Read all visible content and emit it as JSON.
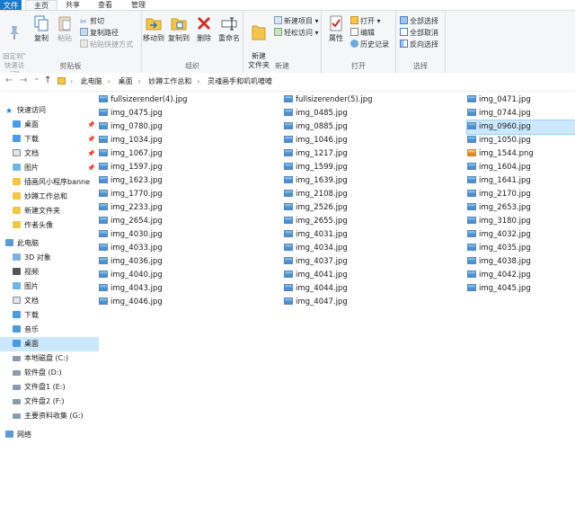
{
  "ribbon_tabs": [
    "文件",
    "主页",
    "共享",
    "查看",
    "管理"
  ],
  "ribbon": {
    "clipboard": {
      "pin": "固定到\"\n快速访问\"",
      "copy": "复制",
      "paste": "粘贴",
      "cut": "剪切",
      "copy_path": "复制路径",
      "paste_shortcut": "粘贴快捷方式",
      "label": "剪贴板"
    },
    "organize": {
      "move_to": "移动到",
      "copy_to": "复制到",
      "delete": "删除",
      "rename": "重命名",
      "label": "组织"
    },
    "new": {
      "new_folder": "新建\n文件夹",
      "new_item": "新建项目 ▾",
      "easy_access": "轻松访问 ▾",
      "label": "新建"
    },
    "open": {
      "properties": "属性",
      "open": "打开 ▾",
      "edit": "编辑",
      "history": "历史记录",
      "label": "打开"
    },
    "select": {
      "select_all": "全部选择",
      "select_none": "全部取消",
      "invert": "反向选择",
      "label": "选择"
    }
  },
  "address": {
    "back": "←",
    "forward": "→",
    "recent": "⌄",
    "up": "↑",
    "crumbs": [
      "此电脑",
      "桌面",
      "妙蹲工作总和",
      "灵魂画手和叽叽喳喳"
    ]
  },
  "nav": {
    "quick_access": "快速访问",
    "quick_items": [
      "桌面",
      "下载",
      "文档",
      "图片",
      "插画风小程序banne",
      "妙蹲工作总和",
      "新建文件夹",
      "作者头像"
    ],
    "this_pc": "此电脑",
    "pc_items": [
      "3D 对象",
      "视频",
      "图片",
      "文档",
      "下载",
      "音乐",
      "桌面",
      "本地磁盘 (C:)",
      "软件盘 (D:)",
      "文件盘1 (E:)",
      "文件盘2 (F:)",
      "主要资料收集 (G:)"
    ],
    "network": "网络"
  },
  "files": {
    "col1": [
      "fullsizerender(4).jpg",
      "img_0475.jpg",
      "img_0780.jpg",
      "img_1034.jpg",
      "img_1067.jpg",
      "img_1597.jpg",
      "img_1623.jpg",
      "img_1770.jpg",
      "img_2233.jpg",
      "img_2654.jpg",
      "img_4030.jpg",
      "img_4033.jpg",
      "img_4036.jpg",
      "img_4040.jpg",
      "img_4043.jpg",
      "img_4046.jpg"
    ],
    "col2": [
      "fullsizerender(5).jpg",
      "img_0485.jpg",
      "img_0885.jpg",
      "img_1046.jpg",
      "img_1217.jpg",
      "img_1599.jpg",
      "img_1639.jpg",
      "img_2108.jpg",
      "img_2526.jpg",
      "img_2655.jpg",
      "img_4031.jpg",
      "img_4034.jpg",
      "img_4037.jpg",
      "img_4041.jpg",
      "img_4044.jpg",
      "img_4047.jpg"
    ],
    "col3": [
      "img_0471.jpg",
      "img_0744.jpg",
      "img_0960.jpg",
      "img_1050.jpg",
      "img_1544.png",
      "img_1604.jpg",
      "img_1641.jpg",
      "img_2170.jpg",
      "img_2653.jpg",
      "img_3180.jpg",
      "img_4032.jpg",
      "img_4035.jpg",
      "img_4038.jpg",
      "img_4042.jpg",
      "img_4045.jpg"
    ],
    "selected": "img_0960.jpg"
  },
  "colors": {
    "accent": "#1979ca",
    "selection": "#cce8ff"
  }
}
